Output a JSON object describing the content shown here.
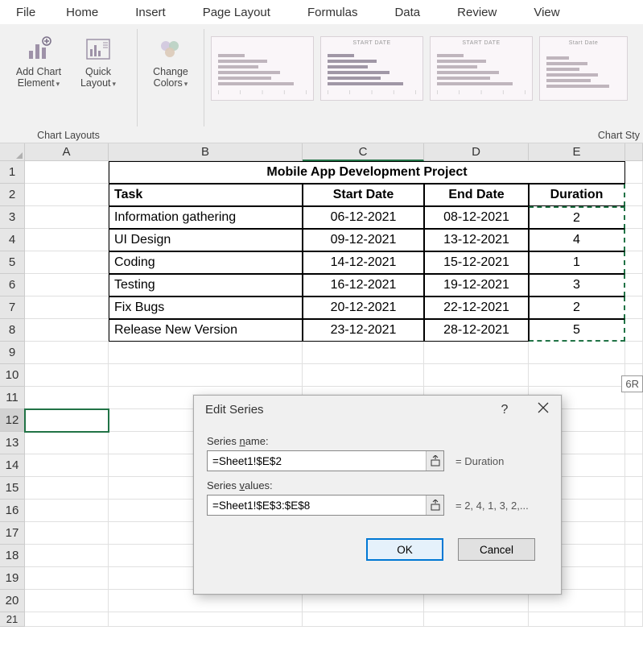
{
  "ribbon": {
    "tabs": [
      "File",
      "Home",
      "Insert",
      "Page Layout",
      "Formulas",
      "Data",
      "Review",
      "View"
    ],
    "group_chart_layouts": "Chart Layouts",
    "add_chart_element": "Add Chart Element",
    "quick_layout": "Quick Layout",
    "change_colors": "Change Colors",
    "group_chart_styles": "Chart Sty"
  },
  "sheet": {
    "columns": [
      "A",
      "B",
      "C",
      "D",
      "E"
    ],
    "title": "Mobile App Development Project",
    "headers": {
      "task": "Task",
      "start": "Start Date",
      "end": "End Date",
      "duration": "Duration"
    },
    "rows": [
      {
        "task": "Information gathering",
        "start": "06-12-2021",
        "end": "08-12-2021",
        "duration": "2"
      },
      {
        "task": "UI Design",
        "start": "09-12-2021",
        "end": "13-12-2021",
        "duration": "4"
      },
      {
        "task": "Coding",
        "start": "14-12-2021",
        "end": "15-12-2021",
        "duration": "1"
      },
      {
        "task": "Testing",
        "start": "16-12-2021",
        "end": "19-12-2021",
        "duration": "3"
      },
      {
        "task": "Fix Bugs",
        "start": "20-12-2021",
        "end": "22-12-2021",
        "duration": "2"
      },
      {
        "task": "Release New Version",
        "start": "23-12-2021",
        "end": "28-12-2021",
        "duration": "5"
      }
    ],
    "rc_badge": "6R"
  },
  "dialog": {
    "title": "Edit Series",
    "series_name_label": "Series name:",
    "series_name_value": "=Sheet1!$E$2",
    "series_name_preview": "= Duration",
    "series_values_label": "Series values:",
    "series_values_value": "=Sheet1!$E$3:$E$8",
    "series_values_preview": "= 2, 4, 1, 3, 2,...",
    "ok": "OK",
    "cancel": "Cancel",
    "help": "?"
  },
  "chart_data": {
    "type": "bar",
    "categories": [
      "Information gathering",
      "UI Design",
      "Coding",
      "Testing",
      "Fix Bugs",
      "Release New Version"
    ],
    "series": [
      {
        "name": "Start Date",
        "values": [
          "06-12-2021",
          "09-12-2021",
          "14-12-2021",
          "16-12-2021",
          "20-12-2021",
          "23-12-2021"
        ]
      },
      {
        "name": "Duration",
        "values": [
          2,
          4,
          1,
          3,
          2,
          5
        ]
      }
    ],
    "title": "Mobile App Development Project"
  }
}
